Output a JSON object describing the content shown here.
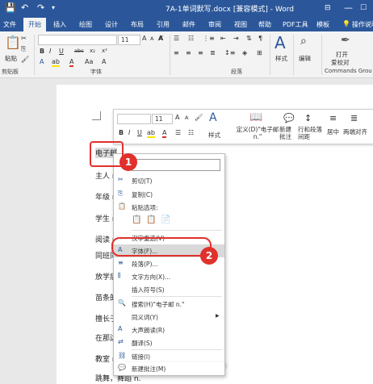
{
  "window": {
    "title": "7A-1单词默写.docx [兼容模式] - Word",
    "icons": [
      "save-icon",
      "undo-icon",
      "redo-icon",
      "customize-icon"
    ],
    "controls": [
      "ribbon-display-icon",
      "minimize-icon",
      "maximize-icon"
    ]
  },
  "tabs": [
    "文件",
    "开始",
    "插入",
    "绘图",
    "设计",
    "布局",
    "引用",
    "邮件",
    "审阅",
    "视图",
    "帮助",
    "PDF工具",
    "模板",
    "操作说明"
  ],
  "ribbon": {
    "clipboard": {
      "paste": "粘贴",
      "group": "剪贴板"
    },
    "font": {
      "size": "11",
      "group": "字体",
      "bold": "B",
      "italic": "I",
      "underline": "U",
      "strike": "abc",
      "sub": "x₂",
      "sup": "x²",
      "grow": "A",
      "shrink": "A",
      "case": "Aa"
    },
    "paragraph": {
      "group": "段落"
    },
    "styles": {
      "label": "样式"
    },
    "editing": {
      "label": "编辑"
    },
    "open_translator": {
      "label1": "打开",
      "label2": "爱校对"
    },
    "commands_group": "Commands Grou"
  },
  "document": {
    "lines": [
      "电子邮",
      "主人 n",
      "年级 n",
      "学生 n",
      "阅读 n",
      "同班同",
      "放学后",
      "苗条的",
      "擅长于",
      "在那边",
      "教室 n",
      "跳舞，舞蹈 n."
    ]
  },
  "mini_toolbar": {
    "size": "11",
    "buttons": [
      "样式",
      "定义(D)\"电子邮 n.\"",
      "新建批注",
      "行和段落间距",
      "居中",
      "两端对齐"
    ],
    "glyphs": [
      "B",
      "I",
      "U",
      "A",
      "A",
      "A"
    ]
  },
  "context_menu": {
    "search_placeholder": "",
    "items": [
      {
        "icon": "✂",
        "label": "剪切(T)"
      },
      {
        "icon": "⎘",
        "label": "复制(C)"
      },
      {
        "icon": "📋",
        "label": "粘贴选项:"
      },
      {
        "icon": "",
        "label": "汉字重选(V)"
      },
      {
        "icon": "A",
        "label": "字体(F)..."
      },
      {
        "icon": "≡",
        "label": "段落(P)..."
      },
      {
        "icon": "⫼",
        "label": "文字方向(X)..."
      },
      {
        "icon": "",
        "label": "插入符号(S)"
      },
      {
        "icon": "🔍",
        "label": "搜索(H)\"电子邮 n.\""
      },
      {
        "icon": "",
        "label": "同义词(Y)"
      },
      {
        "icon": "A",
        "label": "大声朗读(R)"
      },
      {
        "icon": "⇄",
        "label": "翻译(S)"
      },
      {
        "icon": "⛓",
        "label": "链接(I)"
      },
      {
        "icon": "💬",
        "label": "新建批注(M)"
      }
    ]
  },
  "annotations": {
    "step1": "1",
    "step2": "2"
  },
  "colors": {
    "accent": "#2b579a",
    "highlight": "#e0312c"
  }
}
